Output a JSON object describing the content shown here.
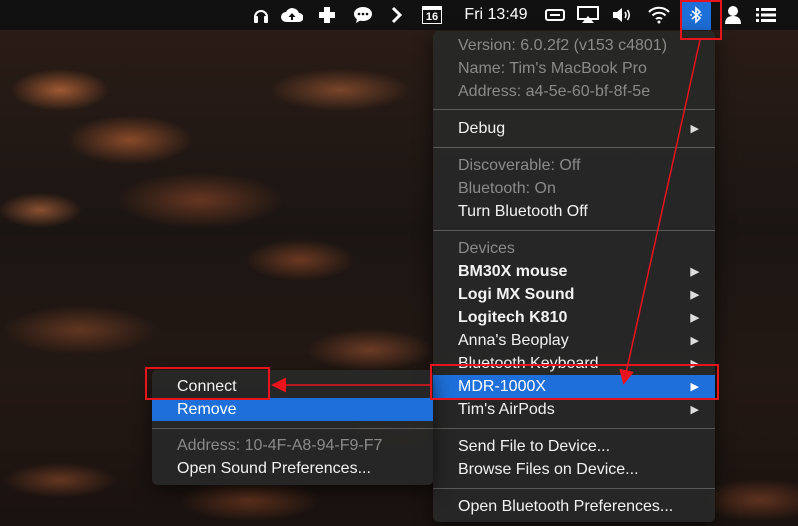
{
  "menubar": {
    "icons": [
      "headphones-icon",
      "cloud-upload-icon",
      "plus-icon",
      "chat-bubble-icon",
      "chevron-right-icon",
      "calendar-icon",
      "display-icon",
      "airplay-icon",
      "volume-icon",
      "wifi-icon",
      "bluetooth-icon",
      "user-icon",
      "list-icon"
    ],
    "calendar_day": "16",
    "clock": "Fri 13:49"
  },
  "bt_menu": {
    "info": [
      "Version: 6.0.2f2 (v153 c4801)",
      "Name: Tim's MacBook Pro",
      "Address: a4-5e-60-bf-8f-5e"
    ],
    "debug": "Debug",
    "status": [
      "Discoverable: Off",
      "Bluetooth: On"
    ],
    "turn_off": "Turn Bluetooth Off",
    "devices_header": "Devices",
    "devices": [
      "BM30X mouse",
      "Logi MX Sound",
      "Logitech K810",
      "Anna's Beoplay",
      "Bluetooth Keyboard",
      "MDR-1000X",
      "Tim's AirPods"
    ],
    "send_file": "Send File to Device...",
    "browse_files": "Browse Files on Device...",
    "open_prefs": "Open Bluetooth Preferences..."
  },
  "sub_menu": {
    "connect": "Connect",
    "remove": "Remove",
    "address": "Address: 10-4F-A8-94-F9-F7",
    "open_sound": "Open Sound Preferences..."
  },
  "colors": {
    "accent": "#1e6fd9",
    "annotation": "#e8141c"
  }
}
